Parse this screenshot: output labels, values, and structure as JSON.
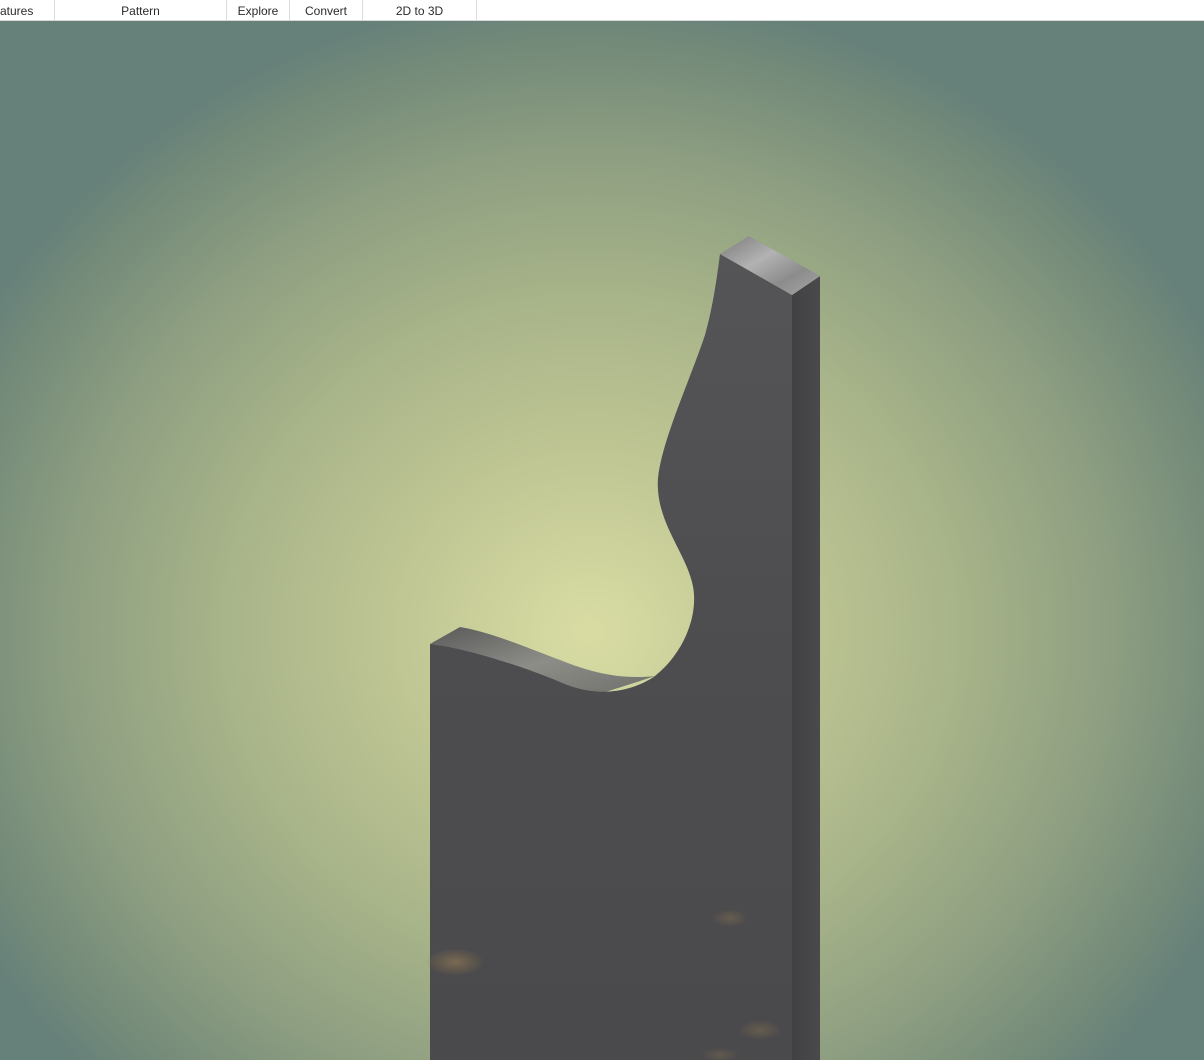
{
  "ribbon": {
    "tabs": [
      {
        "label": "atures"
      },
      {
        "label": "Pattern"
      },
      {
        "label": "Explore"
      },
      {
        "label": "Convert"
      },
      {
        "label": "2D to 3D"
      }
    ]
  },
  "viewport": {
    "model": "extruded-profile-solid",
    "colors": {
      "background_center": "#d9dda4",
      "background_edge": "#66807a",
      "front_face": "#4e4e50",
      "side_face": "#444446",
      "top_face": "#8a8a8a"
    }
  }
}
